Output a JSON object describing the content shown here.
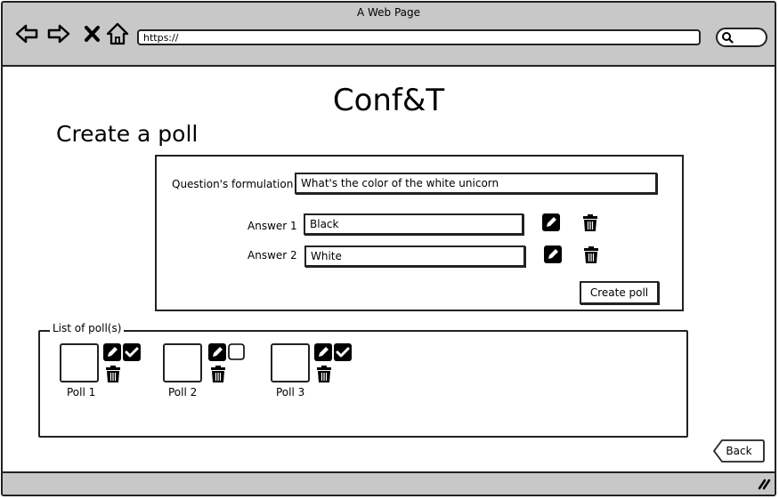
{
  "window": {
    "title": "A Web Page"
  },
  "browser": {
    "url": "https://",
    "back_icon": "back-arrow-icon",
    "forward_icon": "forward-arrow-icon",
    "close_icon": "close-x-icon",
    "home_icon": "home-icon",
    "search_icon": "search-icon"
  },
  "page": {
    "title": "Conf&T",
    "section_title": "Create a poll"
  },
  "form": {
    "question_label": "Question's formulation",
    "question_value": "What's the color of the white unicorn",
    "answers": [
      {
        "label": "Answer 1",
        "value": "Black"
      },
      {
        "label": "Answer 2",
        "value": "White"
      }
    ],
    "create_button": "Create poll"
  },
  "poll_list": {
    "legend": "List of poll(s)",
    "polls": [
      {
        "label": "Poll 1",
        "checked": true
      },
      {
        "label": "Poll 2",
        "checked": false
      },
      {
        "label": "Poll 3",
        "checked": true
      }
    ]
  },
  "footer": {
    "back_button": "Back"
  },
  "colors": {
    "chrome": "#c8c8c8",
    "ink": "#222222",
    "background": "#ffffff"
  }
}
